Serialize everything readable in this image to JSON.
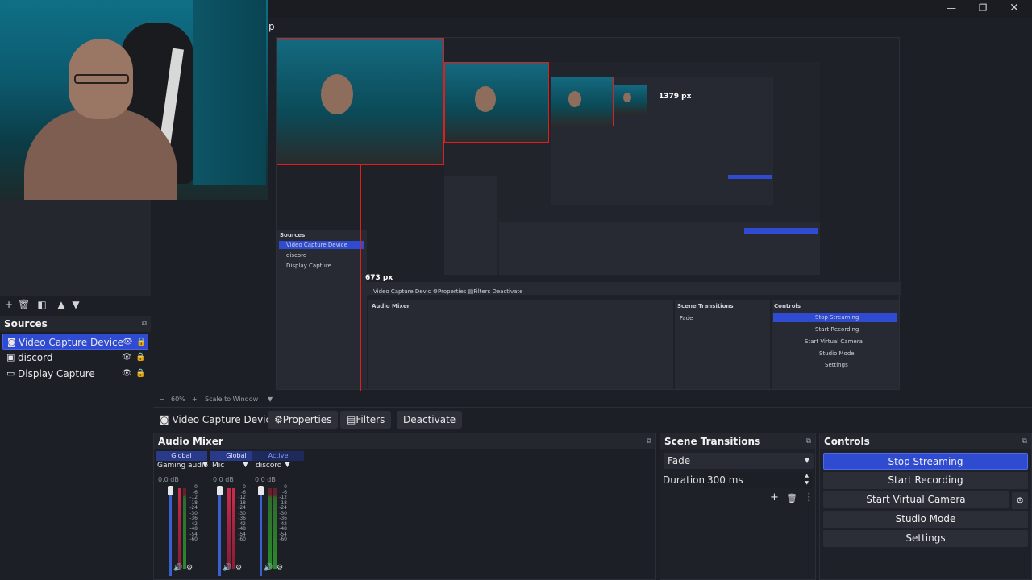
{
  "window": {
    "cursor_char": "p",
    "minimize_icon": "minimize-icon",
    "maximize_icon": "maximize-icon",
    "close_icon": "close-icon"
  },
  "preview": {
    "measure_h": "1379 px",
    "measure_v": "673 px",
    "zoom": "60%",
    "scale_mode": "Scale to Window"
  },
  "source_bar": {
    "name": "Video Capture Devic",
    "properties": "Properties",
    "filters": "Filters",
    "deactivate": "Deactivate"
  },
  "sources": {
    "title": "Sources",
    "items": [
      {
        "label": "Video Capture Device",
        "icon": "camera-icon",
        "selected": true
      },
      {
        "label": "discord",
        "icon": "window-icon",
        "selected": false
      },
      {
        "label": "Display Capture",
        "icon": "monitor-icon",
        "selected": false
      }
    ]
  },
  "audio_mixer": {
    "title": "Audio Mixer",
    "channels": [
      {
        "tag": "Global",
        "name": "Gaming audio",
        "db": "0.0 dB"
      },
      {
        "tag": "Global",
        "name": "Mic",
        "db": "0.0 dB"
      },
      {
        "tag": "Active",
        "name": "discord",
        "db": "0.0 dB"
      }
    ],
    "scale": [
      "0",
      "-6",
      "-12",
      "-18",
      "-24",
      "-30",
      "-36",
      "-42",
      "-48",
      "-54",
      "-60"
    ]
  },
  "scene_transitions": {
    "title": "Scene Transitions",
    "selected": "Fade",
    "duration_label": "Duration",
    "duration_value": "300 ms"
  },
  "controls": {
    "title": "Controls",
    "stop_streaming": "Stop Streaming",
    "start_recording": "Start Recording",
    "start_virtual_camera": "Start Virtual Camera",
    "studio_mode": "Studio Mode",
    "settings": "Settings"
  },
  "colors": {
    "accent": "#2f4bd1",
    "panel": "#1f2129",
    "guide_red": "#e01e1e"
  }
}
